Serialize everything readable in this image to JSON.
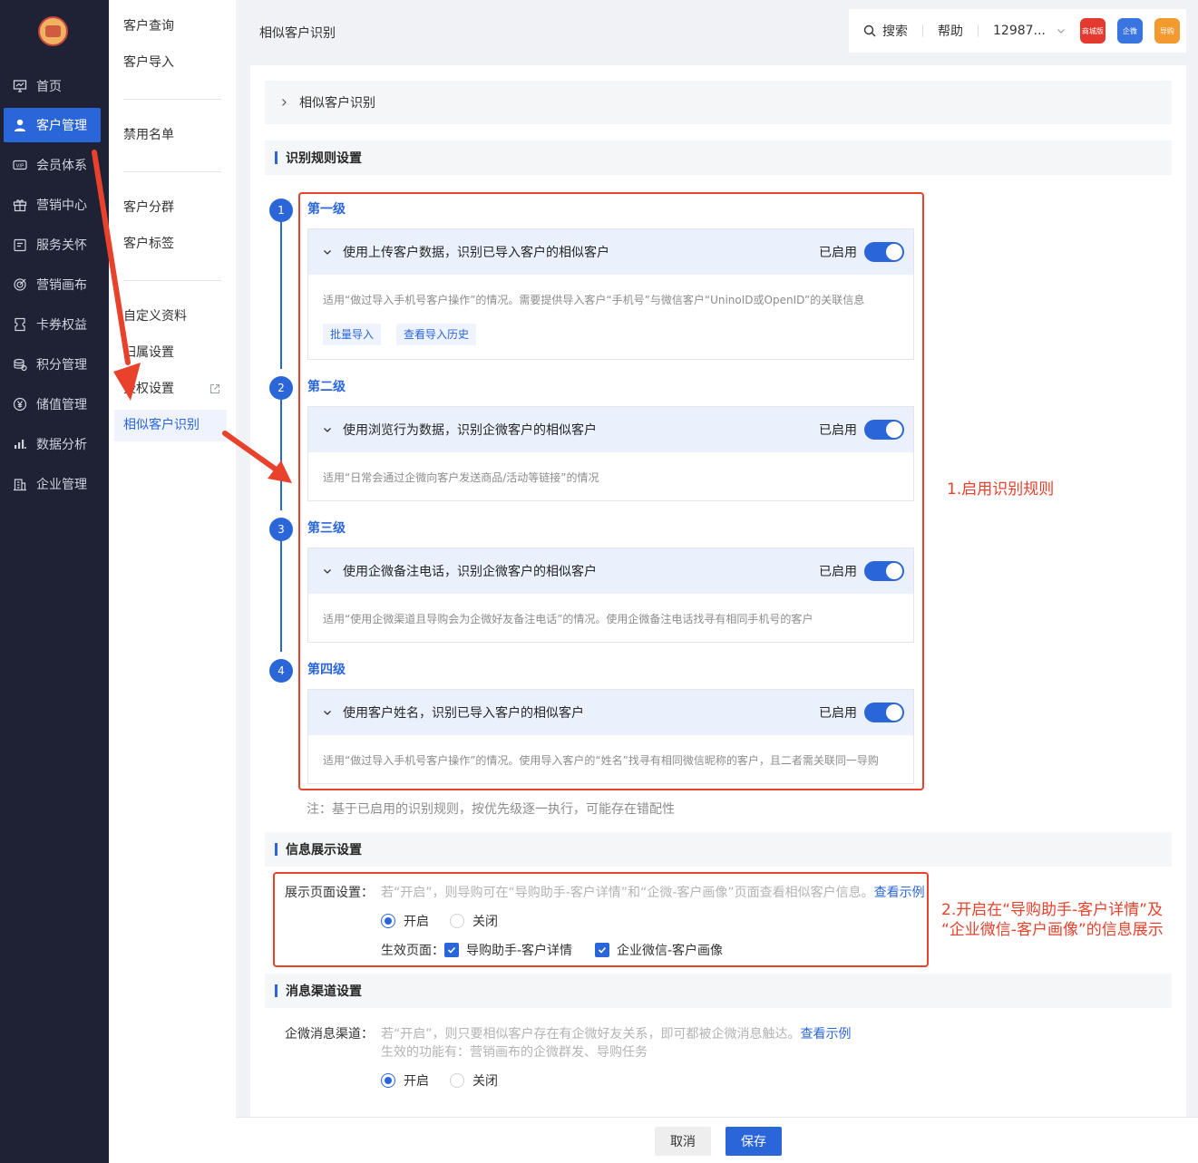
{
  "nav": {
    "items": [
      {
        "label": "首页",
        "icon": "monitor-icon"
      },
      {
        "label": "客户管理",
        "icon": "user-icon"
      },
      {
        "label": "会员体系",
        "icon": "vip-icon"
      },
      {
        "label": "营销中心",
        "icon": "gift-icon"
      },
      {
        "label": "服务关怀",
        "icon": "calendar-icon"
      },
      {
        "label": "营销画布",
        "icon": "target-icon"
      },
      {
        "label": "卡券权益",
        "icon": "coupon-icon"
      },
      {
        "label": "积分管理",
        "icon": "coins-icon"
      },
      {
        "label": "储值管理",
        "icon": "yen-icon"
      },
      {
        "label": "数据分析",
        "icon": "bar-chart-icon"
      },
      {
        "label": "企业管理",
        "icon": "building-icon"
      }
    ],
    "active_index": 1
  },
  "submenu": {
    "items": [
      "客户查询",
      "客户导入",
      "禁用名单",
      "客户分群",
      "客户标签",
      "自定义资料",
      "归属设置",
      "授权设置",
      "相似客户识别"
    ],
    "active": "相似客户识别"
  },
  "header": {
    "page_title": "相似客户识别",
    "search": "搜索",
    "help": "帮助",
    "account": "12987...",
    "apps": [
      "商城版",
      "企微",
      "导购"
    ]
  },
  "collapse": {
    "title": "相似客户识别"
  },
  "rules_section": {
    "title": "识别规则设置",
    "levels": [
      {
        "num": "1",
        "title": "第一级",
        "rule": "使用上传客户数据，识别已导入客户的相似客户",
        "status": "已启用",
        "enabled": true,
        "desc": "适用“做过导入手机号客户操作”的情况。需要提供导入客户“手机号”与微信客户“UninoID或OpenID”的关联信息",
        "actions": [
          "批量导入",
          "查看导入历史"
        ]
      },
      {
        "num": "2",
        "title": "第二级",
        "rule": "使用浏览行为数据，识别企微客户的相似客户",
        "status": "已启用",
        "enabled": true,
        "desc": "适用“日常会通过企微向客户发送商品/活动等链接”的情况"
      },
      {
        "num": "3",
        "title": "第三级",
        "rule": "使用企微备注电话，识别企微客户的相似客户",
        "status": "已启用",
        "enabled": true,
        "desc": "适用“使用企微渠道且导购会为企微好友备注电话”的情况。使用企微备注电话找寻有相同手机号的客户"
      },
      {
        "num": "4",
        "title": "第四级",
        "rule": "使用客户姓名，识别已导入客户的相似客户",
        "status": "已启用",
        "enabled": true,
        "desc": "适用“做过导入手机号客户操作”的情况。使用导入客户的“姓名”找寻有相同微信昵称的客户，且二者需关联同一导购"
      }
    ],
    "note": "注：基于已启用的识别规则，按优先级逐一执行，可能存在错配性"
  },
  "display_section": {
    "title": "信息展示设置",
    "label": "展示页面设置：",
    "hint": "若“开启”，则导购可在“导购助手-客户详情”和“企微-客户画像”页面查看相似客户信息。",
    "hint_link": "查看示例",
    "radio_on": "开启",
    "radio_off": "关闭",
    "selected": "开启",
    "effective_label": "生效页面：",
    "checks": [
      {
        "label": "导购助手-客户详情",
        "checked": true
      },
      {
        "label": "企业微信-客户画像",
        "checked": true
      }
    ]
  },
  "channel_section": {
    "title": "消息渠道设置",
    "label": "企微消息渠道：",
    "hint1": "若“开启”，则只要相似客户存在有企微好友关系，即可都被企微消息触达。",
    "hint_link": "查看示例",
    "hint2": "生效的功能有：营销画布的企微群发、导购任务",
    "radio_on": "开启",
    "radio_off": "关闭",
    "selected": "开启"
  },
  "annotations": {
    "step1": "1.启用识别规则",
    "step2_line1": "2.开启在“导购助手-客户详情”及",
    "step2_line2": "“企业微信-客户画像”的信息展示"
  },
  "footer": {
    "cancel": "取消",
    "save": "保存"
  },
  "colors": {
    "accent": "#2b66d9",
    "nav_bg": "#1f2235",
    "annotation": "#e8412c"
  }
}
